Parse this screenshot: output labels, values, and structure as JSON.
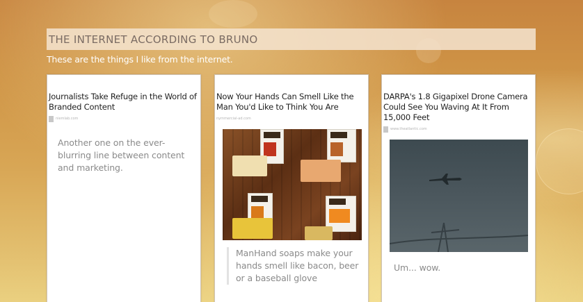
{
  "site": {
    "title": "THE INTERNET ACCORDING TO BRUNO",
    "tagline": "These are the things I like from the internet."
  },
  "cards": [
    {
      "title": "Journalists Take Refuge in the World of Branded Content",
      "source": "niemlab.com",
      "source_icon": "source-favicon-icon",
      "quote": "Another one on the ever-blurring line between content and marketing."
    },
    {
      "title": "Now Your Hands Can Smell Like the Man You'd Like to Think You Are",
      "source": "nymmercial-ad.com",
      "image": "manhands-soap-photo",
      "quote": "ManHand soaps make your hands smell like bacon, beer or a baseball glove"
    },
    {
      "title": "DARPA's 1.8 Gigapixel Drone Camera Could See You Waving At It From 15,000 Feet",
      "source": "www.theatlantic.com",
      "source_icon": "source-favicon-icon",
      "image": "drone-plane-photo",
      "quote": "Um... wow."
    }
  ],
  "colors": {
    "background_top": "#c7843f",
    "background_bottom": "#ead080",
    "header_bar": "#f5e4d0",
    "title_text": "#7a6b63",
    "quote_text": "#8a8a8a"
  }
}
